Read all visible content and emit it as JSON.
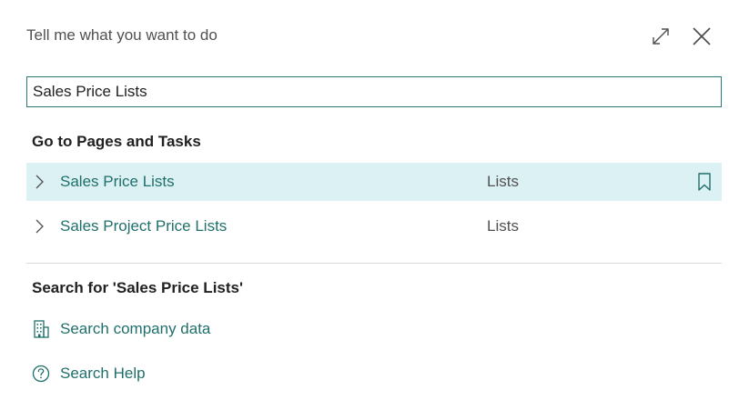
{
  "header": {
    "title": "Tell me what you want to do",
    "expand_icon": "expand-icon",
    "close_icon": "close-icon"
  },
  "search": {
    "value": "Sales Price Lists",
    "placeholder": ""
  },
  "pages_and_tasks": {
    "heading": "Go to Pages and Tasks",
    "results": [
      {
        "label": "Sales Price Lists",
        "category": "Lists",
        "selected": true,
        "icon": "chevron-right-icon",
        "bookmark_icon": "bookmark-icon"
      },
      {
        "label": "Sales Project Price Lists",
        "category": "Lists",
        "selected": false,
        "icon": "chevron-right-icon"
      }
    ]
  },
  "search_for": {
    "heading": "Search for 'Sales Price Lists'",
    "actions": [
      {
        "label": "Search company data",
        "icon": "building-icon"
      },
      {
        "label": "Search Help",
        "icon": "help-circle-icon"
      }
    ]
  },
  "colors": {
    "accent": "#1f6f6b",
    "selected_row": "#dcf1f3",
    "input_border": "#2b7a78"
  }
}
